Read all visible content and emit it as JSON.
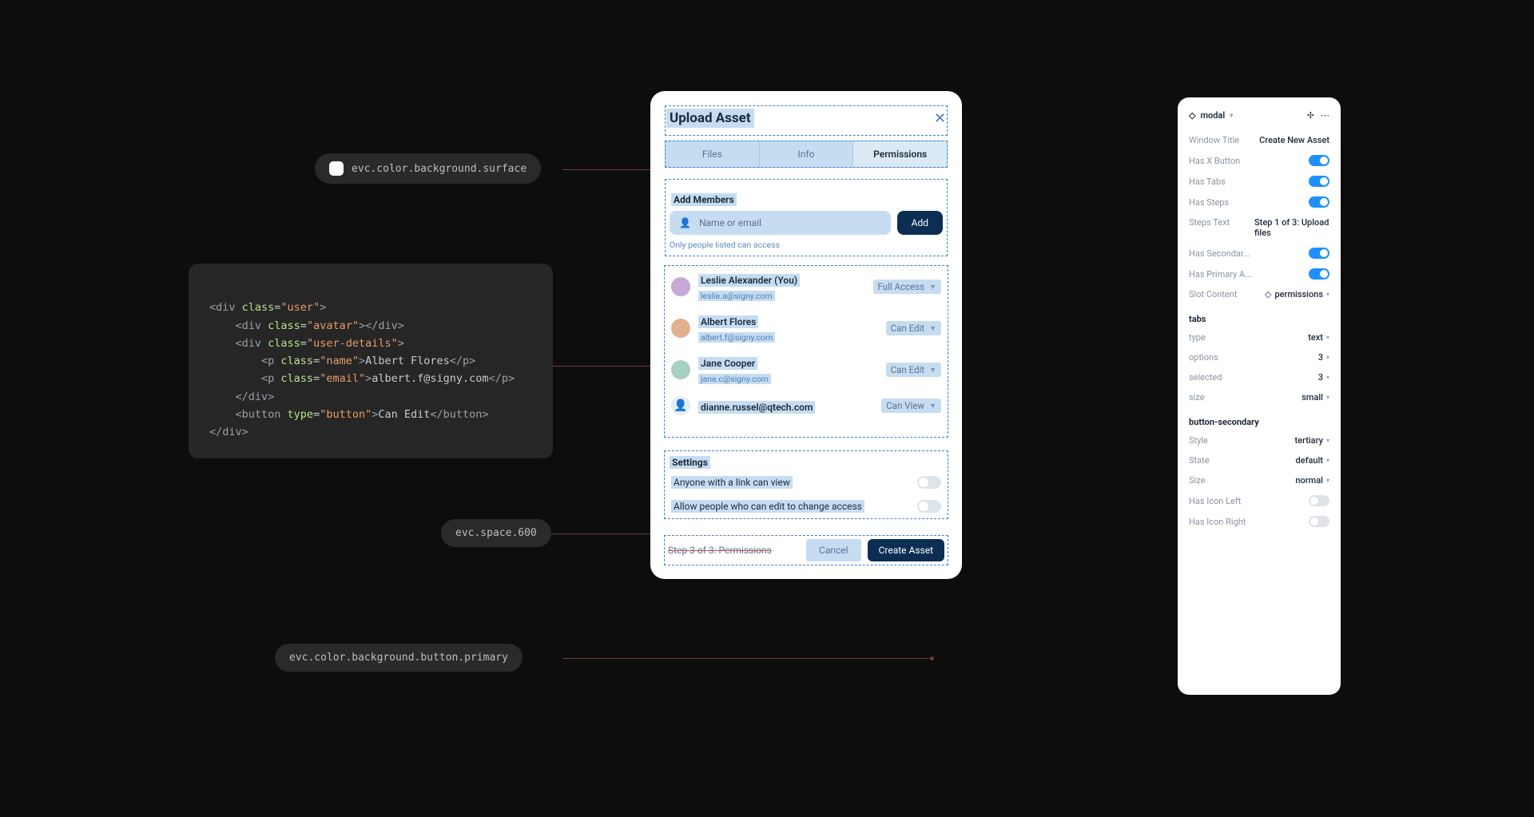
{
  "tokens": {
    "surface": "evc.color.background.surface",
    "space": "evc.space.600",
    "buttonPrimary": "evc.color.background.button.primary"
  },
  "code": {
    "l1": {
      "open": "<div ",
      "attr": "class",
      "val": "user",
      "close": ">"
    },
    "l2": {
      "open": "<div ",
      "attr": "class",
      "val": "avatar",
      "close": "></div>"
    },
    "l3": {
      "open": "<div ",
      "attr": "class",
      "val": "user-details",
      "close": ">"
    },
    "l4": {
      "open": "<p ",
      "attr": "class",
      "val": "name",
      "mid": ">Albert Flores",
      "close": "</p>"
    },
    "l5": {
      "open": "<p ",
      "attr": "class",
      "val": "email",
      "mid": ">albert.f@signy.com",
      "close": "</p>"
    },
    "l6": {
      "close": "</div>"
    },
    "l7": {
      "open": "<button ",
      "attr": "type",
      "val": "button",
      "mid": ">Can Edit",
      "close": "</button>"
    },
    "l8": {
      "close": "</div>"
    }
  },
  "modal": {
    "title": "Upload Asset",
    "tabs": [
      "Files",
      "Info",
      "Permissions"
    ],
    "addMembersLabel": "Add Members",
    "inputPlaceholder": "Name or email",
    "addBtn": "Add",
    "hint": "Only people listed can access",
    "members": [
      {
        "name": "Leslie Alexander (You)",
        "email": "leslie.a@signy.com",
        "perm": "Full Access"
      },
      {
        "name": "Albert Flores",
        "email": "albert.f@signy.com",
        "perm": "Can Edit"
      },
      {
        "name": "Jane Cooper",
        "email": "jane.c@signy.com",
        "perm": "Can Edit"
      },
      {
        "name": "dianne.russel@qtech.com",
        "email": "",
        "perm": "Can View"
      }
    ],
    "settingsLabel": "Settings",
    "settings": [
      "Anyone with a link can view",
      "Allow people who can edit to change access"
    ],
    "stepsText": "Step 3 of 3: Permissions",
    "cancel": "Cancel",
    "primary": "Create Asset"
  },
  "panel": {
    "component": "modal",
    "props": [
      {
        "k": "Window Title",
        "v": "Create New Asset",
        "type": "text"
      },
      {
        "k": "Has X Button",
        "type": "switch-on"
      },
      {
        "k": "Has Tabs",
        "type": "switch-on"
      },
      {
        "k": "Has Steps",
        "type": "switch-on"
      },
      {
        "k": "Steps Text",
        "v": "Step 1 of 3: Upload files",
        "type": "text"
      },
      {
        "k": "Has Secondar...",
        "type": "switch-on"
      },
      {
        "k": "Has Primary A...",
        "type": "switch-on"
      },
      {
        "k": "Slot Content",
        "v": "permissions",
        "type": "select-diamond"
      }
    ],
    "tabsHeader": "tabs",
    "tabsProps": [
      {
        "k": "type",
        "v": "text"
      },
      {
        "k": "options",
        "v": "3"
      },
      {
        "k": "selected",
        "v": "3"
      },
      {
        "k": "size",
        "v": "small"
      }
    ],
    "btnHeader": "button-secondary",
    "btnProps": [
      {
        "k": "Style",
        "v": "tertiary"
      },
      {
        "k": "State",
        "v": "default"
      },
      {
        "k": "Size",
        "v": "normal"
      },
      {
        "k": "Has Icon Left",
        "type": "switch-off"
      },
      {
        "k": "Has Icon Right",
        "type": "switch-off"
      }
    ]
  }
}
